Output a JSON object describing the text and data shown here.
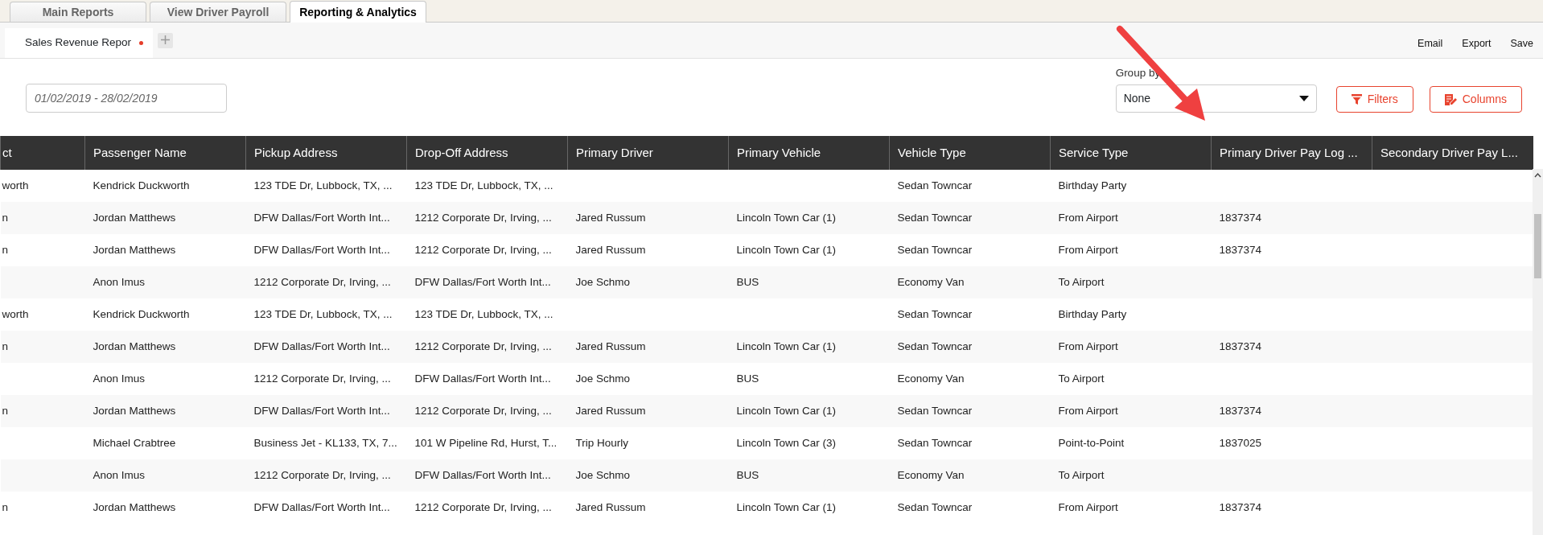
{
  "top_tabs": [
    {
      "label": "Main Reports",
      "selected": false
    },
    {
      "label": "View Driver Payroll",
      "selected": false
    },
    {
      "label": "Reporting & Analytics",
      "selected": true
    }
  ],
  "report_tabs": [
    {
      "label": "Sales Revenue Repor",
      "selected": true,
      "unsaved": true
    }
  ],
  "actions": [
    "Email",
    "Export",
    "Save"
  ],
  "date_range": {
    "value": "01/02/2019 - 28/02/2019"
  },
  "group_by": {
    "label": "Group by",
    "value": "None"
  },
  "buttons": [
    {
      "label": "Filters",
      "kind": "filter"
    },
    {
      "label": "Columns",
      "kind": "columns"
    }
  ],
  "table": {
    "columns": [
      "ct",
      "Passenger Name",
      "Pickup Address",
      "Drop-Off Address",
      "Primary Driver",
      "Primary Vehicle",
      "Vehicle Type",
      "Service Type",
      "Primary Driver Pay Log ...",
      "Secondary Driver Pay L..."
    ],
    "rows": [
      [
        "worth",
        "Kendrick Duckworth",
        "123 TDE Dr, Lubbock, TX, ...",
        "123 TDE Dr, Lubbock, TX, ...",
        "",
        "",
        "Sedan Towncar",
        "Birthday Party",
        "",
        ""
      ],
      [
        "n",
        "Jordan Matthews",
        "DFW Dallas/Fort Worth Int...",
        "1212 Corporate Dr, Irving, ...",
        "Jared Russum",
        "Lincoln Town Car (1)",
        "Sedan Towncar",
        "From Airport",
        "1837374",
        ""
      ],
      [
        "n",
        "Jordan Matthews",
        "DFW Dallas/Fort Worth Int...",
        "1212 Corporate Dr, Irving, ...",
        "Jared Russum",
        "Lincoln Town Car (1)",
        "Sedan Towncar",
        "From Airport",
        "1837374",
        ""
      ],
      [
        "",
        "Anon Imus",
        "1212 Corporate Dr, Irving, ...",
        "DFW Dallas/Fort Worth Int...",
        "Joe Schmo",
        "BUS",
        "Economy Van",
        "To Airport",
        "",
        ""
      ],
      [
        "worth",
        "Kendrick Duckworth",
        "123 TDE Dr, Lubbock, TX, ...",
        "123 TDE Dr, Lubbock, TX, ...",
        "",
        "",
        "Sedan Towncar",
        "Birthday Party",
        "",
        ""
      ],
      [
        "n",
        "Jordan Matthews",
        "DFW Dallas/Fort Worth Int...",
        "1212 Corporate Dr, Irving, ...",
        "Jared Russum",
        "Lincoln Town Car (1)",
        "Sedan Towncar",
        "From Airport",
        "1837374",
        ""
      ],
      [
        "",
        "Anon Imus",
        "1212 Corporate Dr, Irving, ...",
        "DFW Dallas/Fort Worth Int...",
        "Joe Schmo",
        "BUS",
        "Economy Van",
        "To Airport",
        "",
        ""
      ],
      [
        "n",
        "Jordan Matthews",
        "DFW Dallas/Fort Worth Int...",
        "1212 Corporate Dr, Irving, ...",
        "Jared Russum",
        "Lincoln Town Car (1)",
        "Sedan Towncar",
        "From Airport",
        "1837374",
        ""
      ],
      [
        "",
        "Michael Crabtree",
        "Business Jet - KL133, TX, 7...",
        "101 W Pipeline Rd, Hurst, T...",
        "Trip Hourly",
        "Lincoln Town Car (3)",
        "Sedan Towncar",
        "Point-to-Point",
        "1837025",
        ""
      ],
      [
        "",
        "Anon Imus",
        "1212 Corporate Dr, Irving, ...",
        "DFW Dallas/Fort Worth Int...",
        "Joe Schmo",
        "BUS",
        "Economy Van",
        "To Airport",
        "",
        ""
      ],
      [
        "n",
        "Jordan Matthews",
        "DFW Dallas/Fort Worth Int...",
        "1212 Corporate Dr, Irving, ...",
        "Jared Russum",
        "Lincoln Town Car (1)",
        "Sedan Towncar",
        "From Airport",
        "1837374",
        ""
      ]
    ]
  }
}
